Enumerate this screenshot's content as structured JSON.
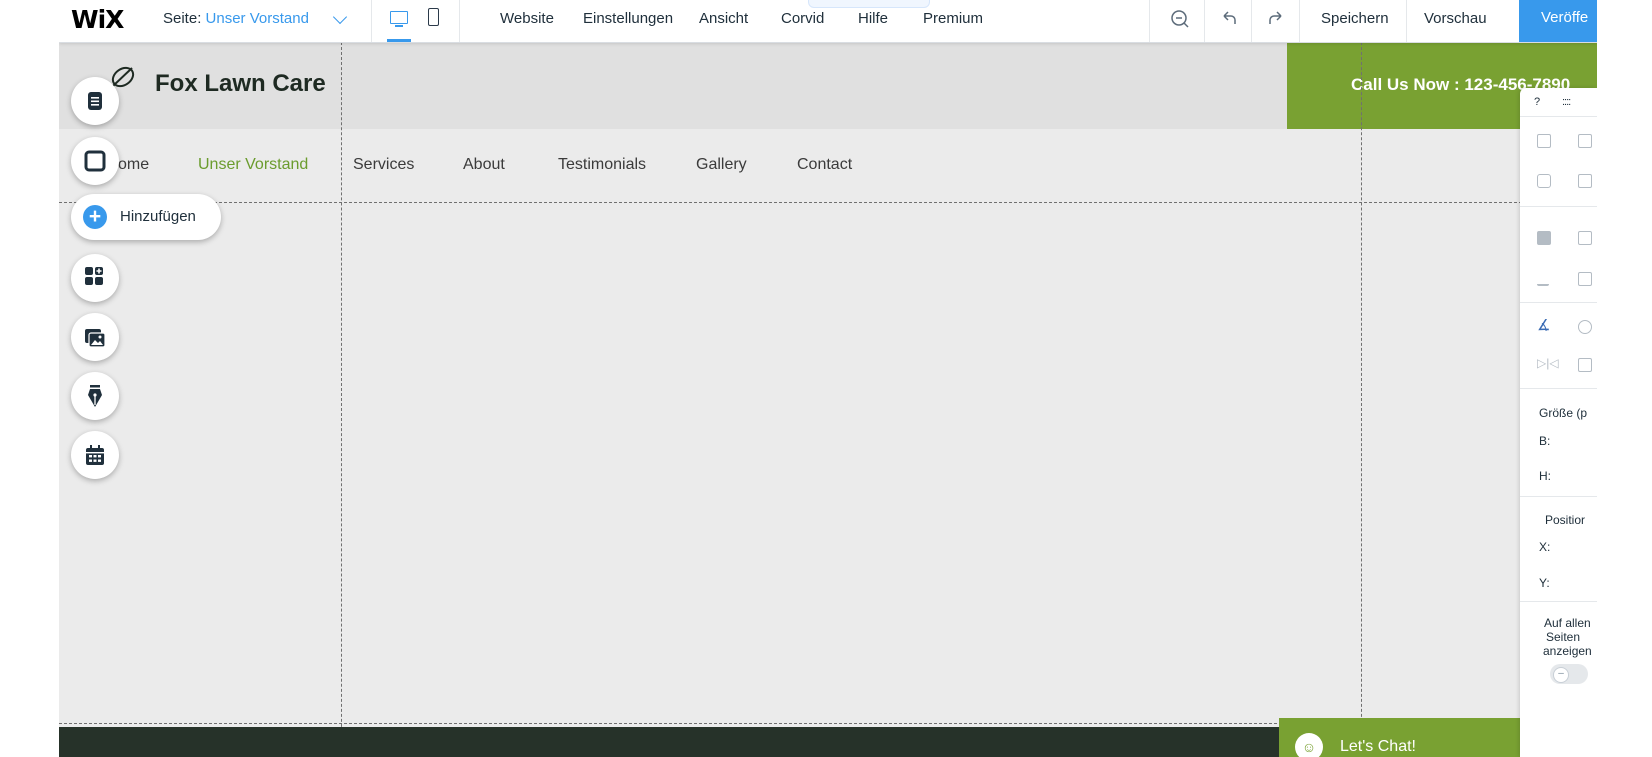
{
  "topbar": {
    "logo": "WiX",
    "page_label": "Seite:",
    "page_value": "Unser Vorstand",
    "menu": [
      "Website",
      "Einstellungen",
      "Ansicht",
      "Corvid",
      "Hilfe",
      "Premium"
    ],
    "save_label": "Speichern",
    "preview_label": "Vorschau",
    "publish_label": "Veröffe"
  },
  "site": {
    "brand": "Fox Lawn Care",
    "cta": "Call Us Now : 123-456-7890",
    "nav": [
      "ome",
      "Unser Vorstand",
      "Services",
      "About",
      "Testimonials",
      "Gallery",
      "Contact"
    ],
    "chat_label": "Let's Chat!"
  },
  "tools": {
    "add_label": "Hinzufügen"
  },
  "panel": {
    "help": "?",
    "handle": "::::",
    "size_label": "Größe (p",
    "w_label": "B:",
    "h_label": "H:",
    "position_label": "Positior",
    "x_label": "X:",
    "y_label": "Y:",
    "show_all_pages": [
      "Auf allen",
      "Seiten",
      "anzeigen"
    ]
  },
  "colors": {
    "accent": "#3899ec",
    "brand_green": "#79a132",
    "footer_dark": "#263229"
  }
}
